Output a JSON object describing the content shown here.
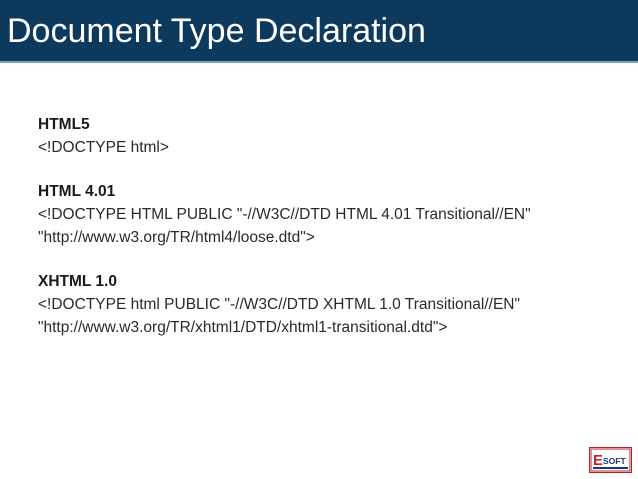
{
  "slide": {
    "title": "Document Type Declaration"
  },
  "entries": [
    {
      "heading": "HTML5",
      "lines": [
        "<!DOCTYPE html>"
      ]
    },
    {
      "heading": "HTML 4.01",
      "lines": [
        "<!DOCTYPE HTML PUBLIC \"-//W3C//DTD HTML 4.01 Transitional//EN\"",
        "\"http://www.w3.org/TR/html4/loose.dtd\">"
      ]
    },
    {
      "heading": "XHTML 1.0",
      "lines": [
        "<!DOCTYPE html PUBLIC \"-//W3C//DTD XHTML 1.0 Transitional//EN\"",
        "\"http://www.w3.org/TR/xhtml1/DTD/xhtml1-transitional.dtd\">"
      ]
    }
  ],
  "logo": {
    "text": "ESOFT",
    "colors": {
      "red": "#c8202c",
      "navy": "#173a7a"
    }
  }
}
